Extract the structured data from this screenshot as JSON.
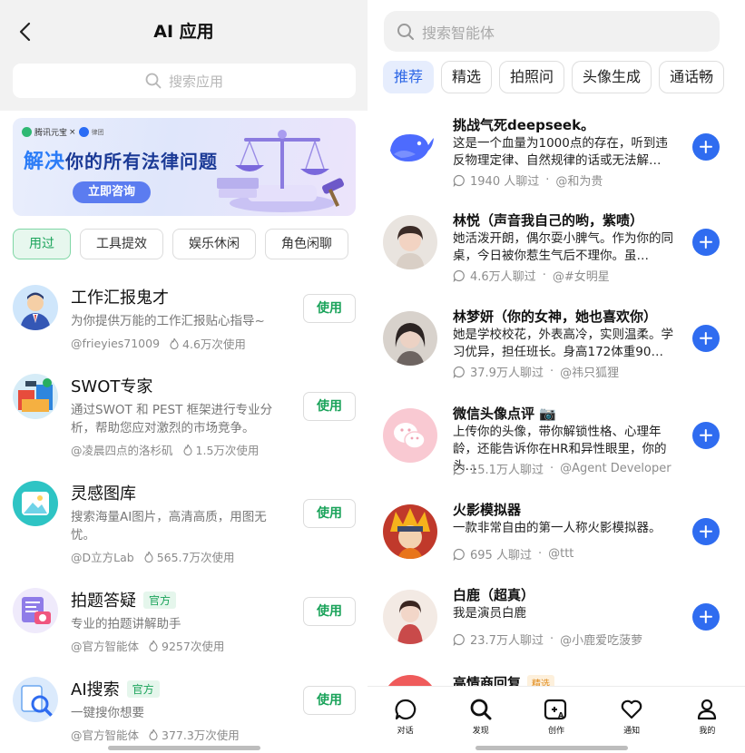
{
  "left": {
    "title": "AI 应用",
    "search_placeholder": "搜索应用",
    "banner": {
      "brand_left": "腾讯元宝",
      "brand_sep": "×",
      "brand_right": "律团",
      "title_highlight": "解决",
      "title_rest": "你的所有法律问题",
      "cta": "立即咨询"
    },
    "categories": [
      "用过",
      "工具提效",
      "娱乐休闲",
      "角色闲聊"
    ],
    "use_label": "使用",
    "apps": [
      {
        "name": "工作汇报鬼才",
        "badge": "",
        "desc": "为你提供万能的工作汇报贴心指导~",
        "author": "@frieyies71009",
        "uses": "4.6万次使用"
      },
      {
        "name": "SWOT专家",
        "badge": "",
        "desc": "通过SWOT 和 PEST 框架进行专业分析，帮助您应对激烈的市场竞争。",
        "author": "@凌晨四点的洛杉矶",
        "uses": "1.5万次使用"
      },
      {
        "name": "灵感图库",
        "badge": "",
        "desc": "搜索海量AI图片，高清高质，用图无忧。",
        "author": "@D立方Lab",
        "uses": "565.7万次使用"
      },
      {
        "name": "拍题答疑",
        "badge": "官方",
        "desc": "专业的拍题讲解助手",
        "author": "@官方智能体",
        "uses": "9257次使用"
      },
      {
        "name": "AI搜索",
        "badge": "官方",
        "desc": "一键搜你想要",
        "author": "@官方智能体",
        "uses": "377.3万次使用"
      }
    ]
  },
  "right": {
    "search_placeholder": "搜索智能体",
    "tabs": [
      "推荐",
      "精选",
      "拍照问",
      "头像生成",
      "通话畅"
    ],
    "bots": [
      {
        "name": "挑战气死deepseek。",
        "badge": "",
        "desc": "这是一个血量为1000点的存在，听到违反物理定律、自然规律的话或无法解…",
        "chats": "1940 人聊过",
        "author": "@和为贵"
      },
      {
        "name": "林悦（声音我自己的哟，紫啧）",
        "badge": "",
        "desc": "她活泼开朗，偶尔耍小脾气。作为你的同桌，今日被你惹生气后不理你。虽…",
        "chats": "4.6万人聊过",
        "author": "@#女明星"
      },
      {
        "name": "林梦妍（你的女神，她也喜欢你）",
        "badge": "",
        "desc": "她是学校校花，外表高冷，实则温柔。学习优异，担任班长。身高172体重90…",
        "chats": "37.9万人聊过",
        "author": "@祎只狐狸"
      },
      {
        "name": "微信头像点评 📷",
        "badge": "",
        "desc": "上传你的头像，带你解锁性格、心理年龄，还能告诉你在HR和异性眼里，你的头…",
        "chats": "15.1万人聊过",
        "author": "@Agent Developer"
      },
      {
        "name": "火影模拟器",
        "badge": "",
        "desc": "一款非常自由的第一人称火影模拟器。",
        "chats": "695 人聊过",
        "author": "@ttt"
      },
      {
        "name": "白鹿（超真）",
        "badge": "",
        "desc": "我是演员白鹿",
        "chats": "23.7万人聊过",
        "author": "@小鹿爱吃菠萝"
      },
      {
        "name": "高情商回复",
        "badge": "精选",
        "desc": "",
        "chats": "",
        "author": ""
      }
    ],
    "tabbar": [
      "对话",
      "发现",
      "创作",
      "通知",
      "我的"
    ]
  }
}
